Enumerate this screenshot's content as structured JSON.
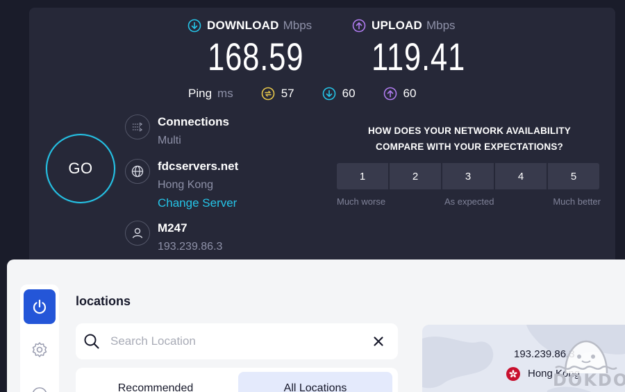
{
  "speedtest": {
    "download": {
      "label": "DOWNLOAD",
      "unit": "Mbps",
      "value": "168.59"
    },
    "upload": {
      "label": "UPLOAD",
      "unit": "Mbps",
      "value": "119.41"
    },
    "ping": {
      "label": "Ping",
      "unit": "ms",
      "idle": "57",
      "download": "60",
      "upload": "60"
    },
    "go_label": "GO",
    "connections": {
      "title": "Connections",
      "value": "Multi"
    },
    "server": {
      "title": "fdcservers.net",
      "location": "Hong Kong",
      "change_label": "Change Server"
    },
    "provider": {
      "title": "M247",
      "ip": "193.239.86.3"
    },
    "survey": {
      "question_line1": "HOW DOES YOUR NETWORK AVAILABILITY",
      "question_line2": "COMPARE WITH YOUR EXPECTATIONS?",
      "options": [
        "1",
        "2",
        "3",
        "4",
        "5"
      ],
      "label_low": "Much worse",
      "label_mid": "As expected",
      "label_high": "Much better"
    },
    "colors": {
      "download_accent": "#25c5e8",
      "upload_accent": "#b07cf0",
      "ping_accent": "#e8c84a"
    }
  },
  "vpn_app": {
    "section_title": "locations",
    "search": {
      "placeholder": "Search Location",
      "value": ""
    },
    "tabs": [
      {
        "label": "Recommended"
      },
      {
        "label": "All Locations"
      }
    ],
    "map": {
      "ip": "193.239.86.3",
      "city": "Hong Kong"
    },
    "accent_color": "#2456d8"
  },
  "watermark": {
    "text": "DOKDO"
  }
}
